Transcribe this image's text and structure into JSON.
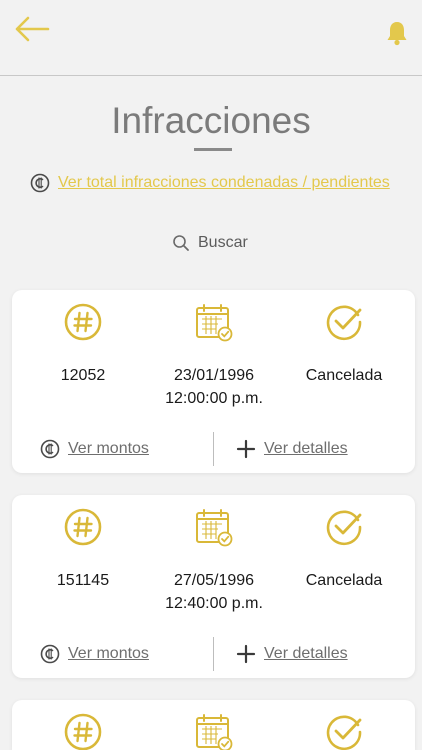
{
  "header": {
    "back_icon": "arrow-left-icon",
    "notification_icon": "bell-icon",
    "accent": "#e3c84c"
  },
  "page": {
    "title": "Infracciones",
    "total_link": "Ver total infracciones condenadas / pendientes",
    "search_placeholder": "Buscar"
  },
  "infractions": [
    {
      "number": "12052",
      "date": "23/01/1996",
      "time": "12:00:00 p.m.",
      "status": "Cancelada",
      "amounts_label": "Ver montos",
      "details_label": "Ver detalles"
    },
    {
      "number": "151145",
      "date": "27/05/1996",
      "time": "12:40:00 p.m.",
      "status": "Cancelada",
      "amounts_label": "Ver montos",
      "details_label": "Ver detalles"
    }
  ]
}
